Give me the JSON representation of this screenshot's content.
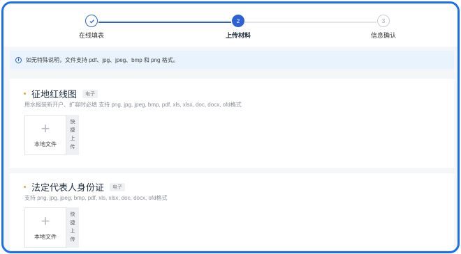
{
  "stepper": {
    "steps": [
      {
        "label": "在线填表",
        "number": "",
        "state": "done",
        "icon": "check-icon"
      },
      {
        "label": "上传材料",
        "number": "2",
        "state": "active"
      },
      {
        "label": "信息确认",
        "number": "3",
        "state": "pending"
      }
    ]
  },
  "notice": {
    "icon": "info-icon",
    "text": "如无特殊说明，文件支持 pdf、jpg、jpeg、bmp 和 png 格式。"
  },
  "sections": [
    {
      "title": "征地红线图",
      "tag": "电子",
      "hint": "用水报装新开户、扩容时必填   支持 png, jpg, jpeg, bmp, pdf, xls, xlsx, doc, docx, ofd格式",
      "upload_plus": "+",
      "upload_label": "本地文件",
      "quick_label": "快捷上传"
    },
    {
      "title": "法定代表人身份证",
      "tag": "电子",
      "hint": "支持 png, jpg, jpeg, bmp, pdf, xls, xlsx, doc, docx, ofd格式",
      "upload_plus": "+",
      "upload_label": "本地文件",
      "quick_label": "快捷上传"
    }
  ],
  "colors": {
    "frame": "#1a6ff0",
    "accent": "#2c62d6",
    "bullet": "#f0a030",
    "notice_bg": "#e8f3fd"
  }
}
